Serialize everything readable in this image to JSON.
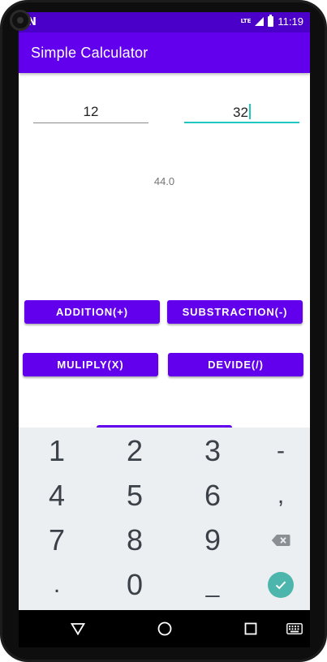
{
  "status_bar": {
    "network": "LTE",
    "time": "11:19"
  },
  "app_bar": {
    "title": "Simple Calculator"
  },
  "inputs": {
    "first_number": "12",
    "second_number": "32"
  },
  "result": {
    "text": "44.0"
  },
  "buttons": {
    "addition": "ADDITION(+)",
    "subtraction": "SUBSTRACTION(-)",
    "multiply": "MULIPLY(X)",
    "divide": "DEVIDE(/)"
  },
  "keyboard": {
    "keys": [
      "1",
      "2",
      "3",
      "-",
      "4",
      "5",
      "6",
      ",",
      "7",
      "8",
      "9",
      "backspace-icon",
      ".",
      "0",
      "_",
      "done-icon"
    ]
  },
  "colors": {
    "primary": "#6200ee",
    "primary_dark": "#4a00c8",
    "accent": "#1ec8c0",
    "keyboard_bg": "#eceff1",
    "done_key": "#4db6ac"
  },
  "nav_bar": {
    "icons": [
      "back-icon",
      "home-icon",
      "recents-icon",
      "keyboard-switch-icon"
    ]
  }
}
